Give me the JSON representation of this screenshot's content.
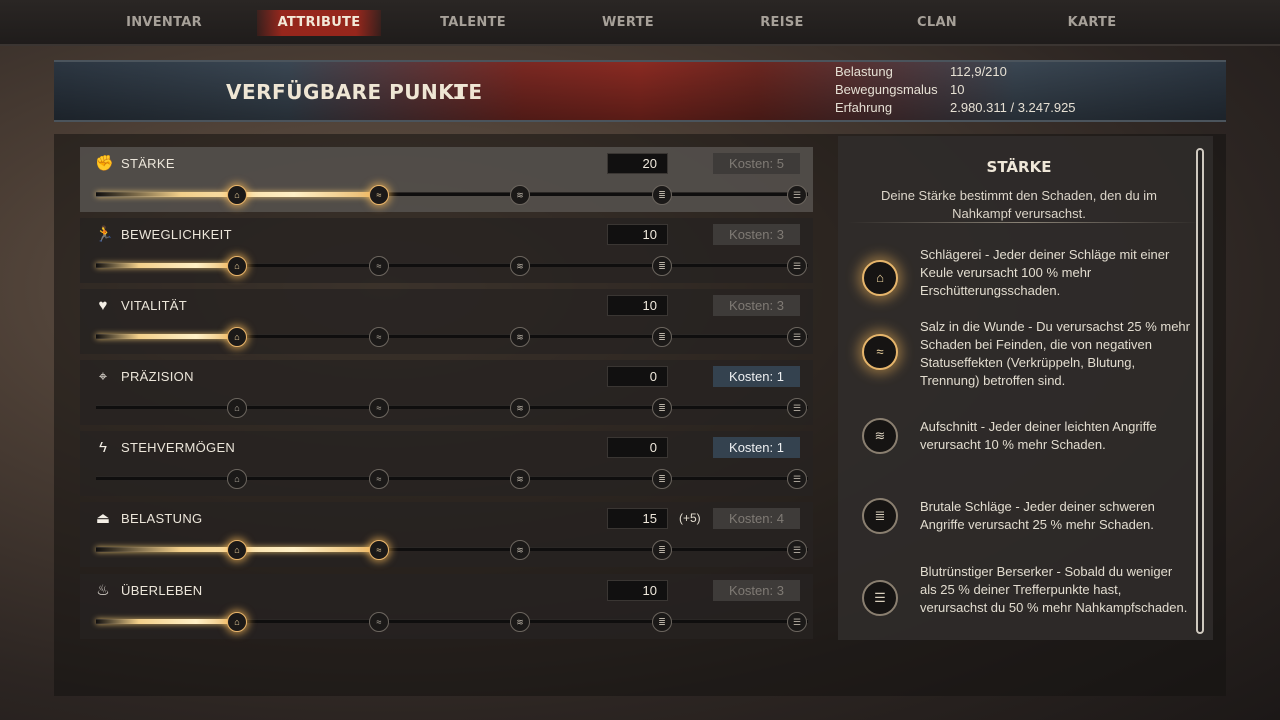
{
  "nav": {
    "tabs": [
      {
        "label": "INVENTAR"
      },
      {
        "label": "ATTRIBUTE"
      },
      {
        "label": "TALENTE"
      },
      {
        "label": "WERTE"
      },
      {
        "label": "REISE"
      },
      {
        "label": "CLAN"
      },
      {
        "label": "KARTE"
      }
    ],
    "active": "ATTRIBUTE"
  },
  "header": {
    "title": "VERFÜGBARE PUNKTE",
    "points": "1",
    "stats": [
      {
        "label": "Belastung",
        "value": "112,9/210"
      },
      {
        "label": "Bewegungsmalus",
        "value": "10"
      },
      {
        "label": "Erfahrung",
        "value": "2.980.311 / 3.247.925"
      }
    ]
  },
  "attributes": [
    {
      "name": "STÄRKE",
      "icon": "fist-icon",
      "value": "20",
      "bonus": "",
      "cost": "Kosten: 5",
      "cost_available": false,
      "progress": 0.4,
      "lit_nodes": 2
    },
    {
      "name": "BEWEGLICHKEIT",
      "icon": "running-icon",
      "value": "10",
      "bonus": "",
      "cost": "Kosten: 3",
      "cost_available": false,
      "progress": 0.2,
      "lit_nodes": 1
    },
    {
      "name": "VITALITÄT",
      "icon": "heart-icon",
      "value": "10",
      "bonus": "",
      "cost": "Kosten: 3",
      "cost_available": false,
      "progress": 0.2,
      "lit_nodes": 1
    },
    {
      "name": "PRÄZISION",
      "icon": "crosshair-icon",
      "value": "0",
      "bonus": "",
      "cost": "Kosten: 1",
      "cost_available": true,
      "progress": 0,
      "lit_nodes": 0
    },
    {
      "name": "STEHVERMÖGEN",
      "icon": "lightning-icon",
      "value": "0",
      "bonus": "",
      "cost": "Kosten: 1",
      "cost_available": true,
      "progress": 0,
      "lit_nodes": 0
    },
    {
      "name": "BELASTUNG",
      "icon": "weight-icon",
      "value": "15",
      "bonus": "(+5)",
      "cost": "Kosten: 4",
      "cost_available": false,
      "progress": 0.4,
      "lit_nodes": 2
    },
    {
      "name": "ÜBERLEBEN",
      "icon": "campfire-icon",
      "value": "10",
      "bonus": "",
      "cost": "Kosten: 3",
      "cost_available": false,
      "progress": 0.2,
      "lit_nodes": 1
    }
  ],
  "description": {
    "title": "STÄRKE",
    "text": "Deine Stärke bestimmt den Schaden, den du im Nahkampf verursachst.",
    "perks": [
      {
        "icon": "perk-tier1-icon",
        "lit": true,
        "text": "Schlägerei - Jeder deiner Schläge mit einer Keule verursacht 100 % mehr Erschütterungsschaden."
      },
      {
        "icon": "perk-tier2-icon",
        "lit": true,
        "text": "Salz in die Wunde - Du verursachst 25 % mehr Schaden bei Feinden, die von negativen Statuseffekten (Verkrüppeln, Blutung, Trennung) betroffen sind."
      },
      {
        "icon": "perk-tier3-icon",
        "lit": false,
        "text": "Aufschnitt - Jeder deiner leichten Angriffe verursacht 10 % mehr Schaden."
      },
      {
        "icon": "perk-tier4-icon",
        "lit": false,
        "text": "Brutale Schläge - Jeder deiner schweren Angriffe verursacht 25 % mehr Schaden."
      },
      {
        "icon": "perk-tier5-icon",
        "lit": false,
        "text": "Blutrünstiger Berserker - Sobald du weniger als 25 % deiner Trefferpunkte hast, verursachst du 50 % mehr Nahkampfschaden."
      }
    ]
  }
}
